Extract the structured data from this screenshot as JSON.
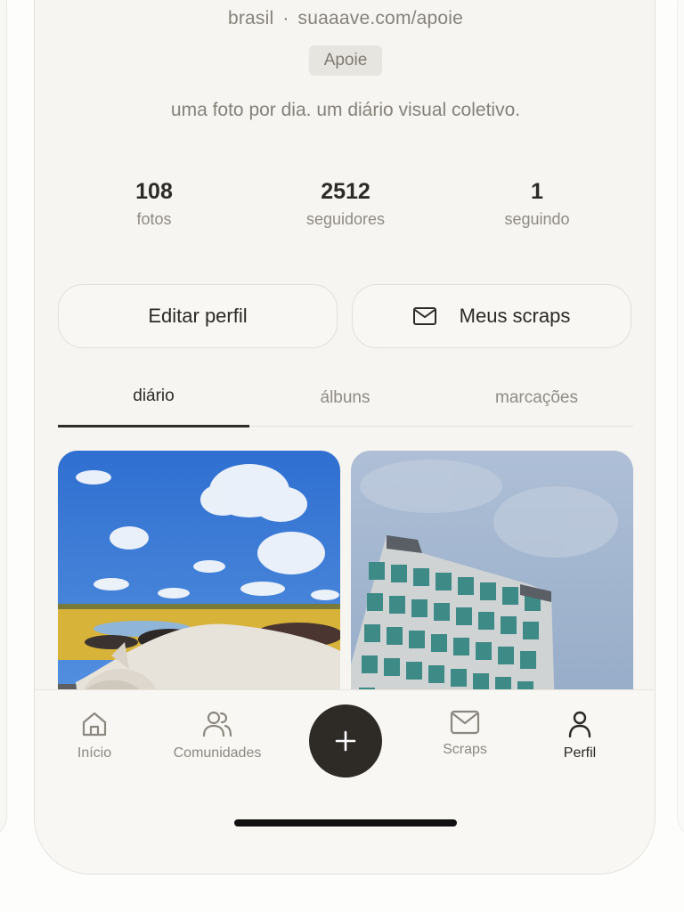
{
  "profile": {
    "location": "brasil",
    "separator": "·",
    "link": "suaaave.com/apoie",
    "badge": "Apoie",
    "bio": "uma foto por dia. um diário visual coletivo.",
    "stats": [
      {
        "value": "108",
        "label": "fotos"
      },
      {
        "value": "2512",
        "label": "seguidores"
      },
      {
        "value": "1",
        "label": "seguindo"
      }
    ]
  },
  "actions": {
    "edit_label": "Editar perfil",
    "scraps_label": "Meus scraps",
    "scraps_icon": "mail-icon"
  },
  "tabs": [
    {
      "label": "diário",
      "active": true
    },
    {
      "label": "álbuns",
      "active": false
    },
    {
      "label": "marcações",
      "active": false
    }
  ],
  "nav": {
    "items": [
      {
        "label": "Início",
        "icon": "home-icon"
      },
      {
        "label": "Comunidades",
        "icon": "people-icon"
      },
      {
        "label": "Scraps",
        "icon": "mail-icon"
      },
      {
        "label": "Perfil",
        "icon": "person-icon",
        "active": true
      }
    ],
    "add_icon": "plus-icon"
  },
  "colors": {
    "background": "#f6f5f1",
    "text_primary": "#2d2a26",
    "text_muted": "#8f8b84",
    "accent_dark": "#2e2b27"
  }
}
